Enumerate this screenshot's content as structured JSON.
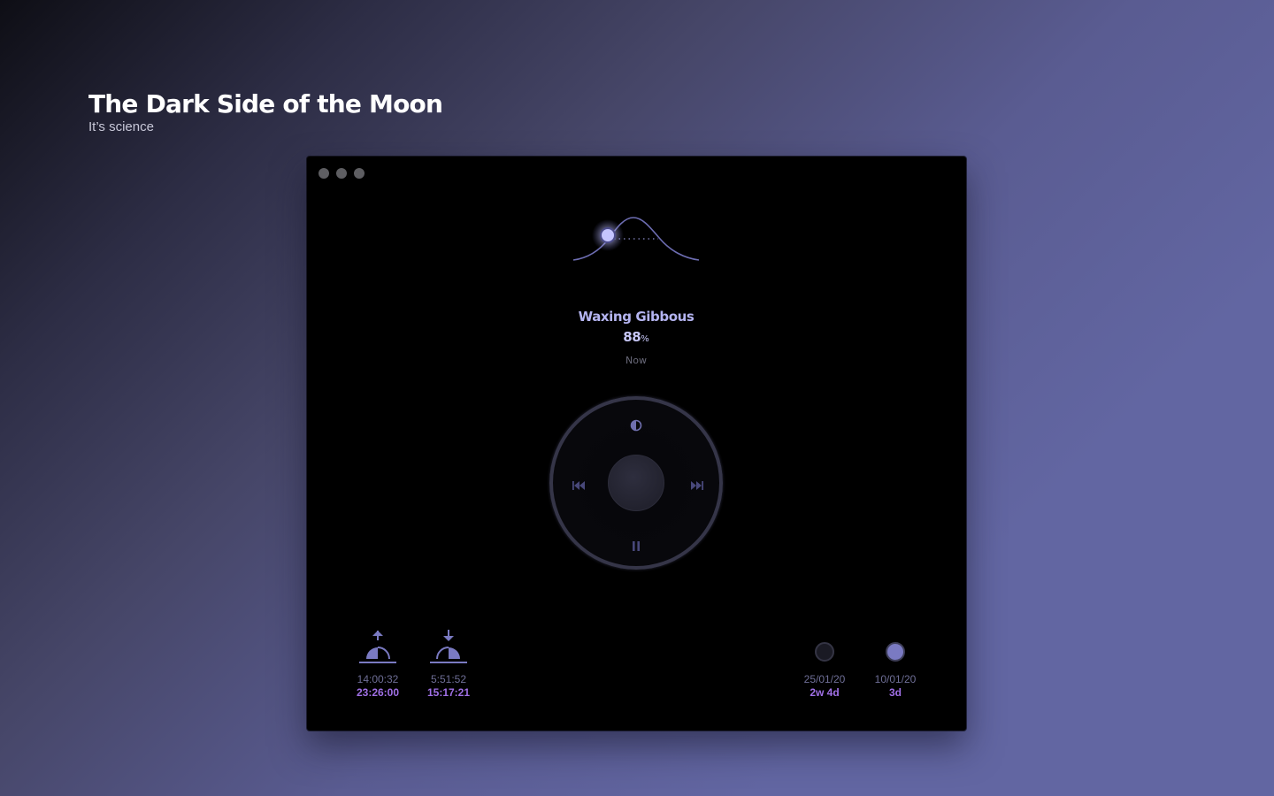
{
  "page": {
    "title": "The Dark Side of the Moon",
    "subtitle": "It’s science"
  },
  "phase": {
    "name": "Waxing Gibbous",
    "illumination_value": "88",
    "illumination_unit": "%",
    "time_label": "Now"
  },
  "controls": {
    "top_icon": "half-moon-icon",
    "left_icon": "skip-back-icon",
    "right_icon": "skip-forward-icon",
    "bottom_icon": "pause-icon"
  },
  "stats": {
    "moonrise": {
      "icon": "moonrise-icon",
      "time": "14:00:32",
      "detail": "23:26:00"
    },
    "moonset": {
      "icon": "moonset-icon",
      "time": "5:51:52",
      "detail": "15:17:21"
    },
    "new_moon": {
      "icon": "new-moon-icon",
      "date": "25/01/20",
      "detail": "2w 4d"
    },
    "full_moon": {
      "icon": "full-moon-icon",
      "date": "10/01/20",
      "detail": "3d"
    }
  },
  "colors": {
    "accent": "#b4b4f0",
    "accent_secondary": "#a070e6",
    "icon": "#7a7ac2",
    "window_bg": "#000000"
  }
}
